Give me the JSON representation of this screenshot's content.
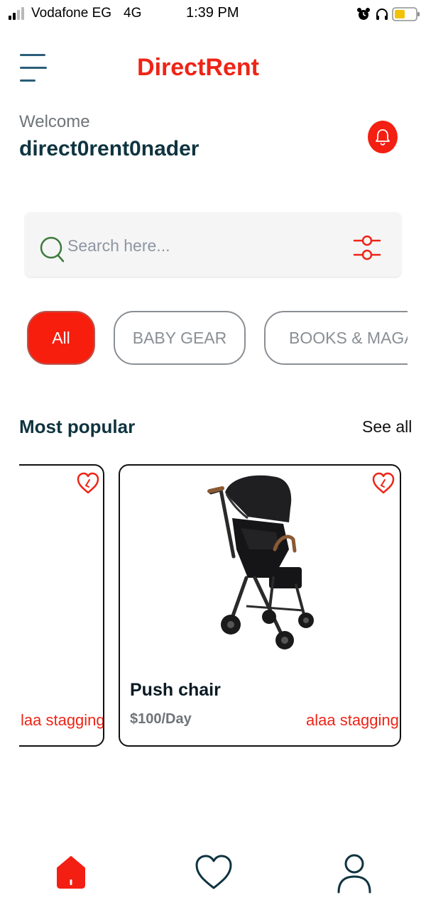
{
  "status_bar": {
    "carrier": "Vodafone EG",
    "network": "4G",
    "time": "1:39 PM",
    "icons": [
      "signal-icon",
      "alarm-icon",
      "headphone-icon",
      "battery-icon"
    ]
  },
  "header": {
    "menu_icon": "hamburger-menu-icon",
    "title": "DirectRent"
  },
  "greeting": {
    "welcome": "Welcome",
    "username": "direct0rent0nader",
    "bell_icon": "bell-icon"
  },
  "search": {
    "placeholder": "Search here...",
    "value": "",
    "search_icon": "search-icon",
    "filter_icon": "filter-sliders-icon"
  },
  "categories": [
    {
      "label": "All",
      "active": true
    },
    {
      "label": "BABY GEAR",
      "active": false
    },
    {
      "label": "BOOKS & MAGAZ",
      "active": false
    }
  ],
  "popular": {
    "title": "Most popular",
    "see_all": "See all",
    "items": [
      {
        "name": "",
        "price": "",
        "owner": "laa stagging"
      },
      {
        "name": "Push chair",
        "price": "$100/Day",
        "owner": "alaa stagging"
      }
    ]
  },
  "bottom_nav": [
    {
      "icon": "home-icon",
      "active": true
    },
    {
      "icon": "heart-icon",
      "active": false
    },
    {
      "icon": "profile-icon",
      "active": false
    }
  ],
  "colors": {
    "brand_red": "#ee2416",
    "chip_active": "#f81e0e",
    "dark_text": "#0f3440",
    "muted_text": "#6f7478"
  }
}
